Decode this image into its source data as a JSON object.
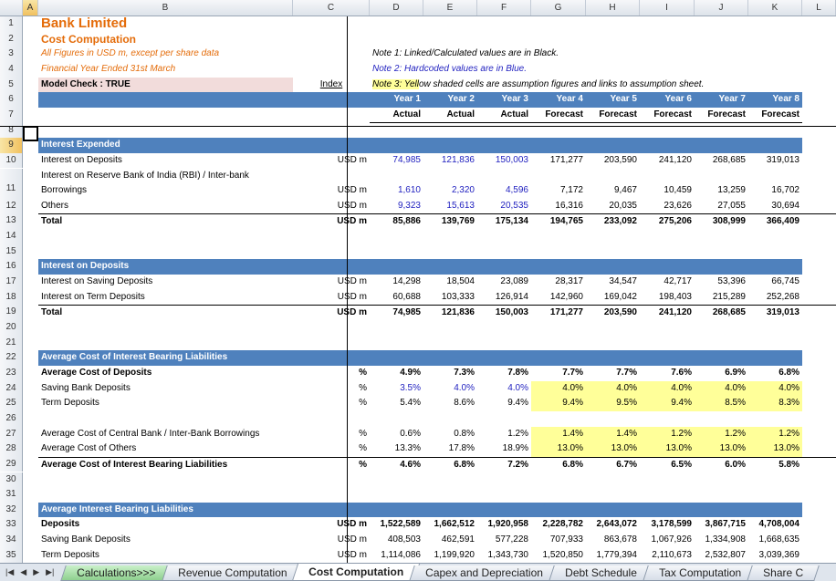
{
  "columns": [
    "",
    "A",
    "B",
    "C",
    "D",
    "E",
    "F",
    "G",
    "H",
    "I",
    "J",
    "K",
    "L"
  ],
  "header": {
    "title": "Bank Limited",
    "subtitle": "Cost Computation",
    "note_figures": "All Figures in USD m, except per share data",
    "note_fy": "Financial Year Ended 31st March",
    "model_check": "Model Check : TRUE",
    "index_link": "Index",
    "note1": "Note 1: Linked/Calculated values are in Black.",
    "note2": "Note 2: Hardcoded values are in Blue.",
    "note3": "Note 3: Yellow shaded cells are assumption figures and links to assumption sheet."
  },
  "years": [
    "Year 1",
    "Year 2",
    "Year 3",
    "Year 4",
    "Year 5",
    "Year 6",
    "Year 7",
    "Year 8"
  ],
  "types": [
    "Actual",
    "Actual",
    "Actual",
    "Forecast",
    "Forecast",
    "Forecast",
    "Forecast",
    "Forecast"
  ],
  "sections": {
    "interest_expended": "Interest Expended",
    "interest_on_deposits": "Interest on Deposits",
    "avg_cost": "Average Cost of Interest Bearing Liabilities",
    "avg_ibl": "Average Interest Bearing Liabilities"
  },
  "rows": {
    "r10": {
      "label": "Interest on Deposits",
      "unit": "USD m",
      "v": [
        "74,985",
        "121,836",
        "150,003",
        "171,277",
        "203,590",
        "241,120",
        "268,685",
        "319,013"
      ]
    },
    "r10b": {
      "label": "Interest on Reserve Bank of India (RBI) / Inter-bank"
    },
    "r11": {
      "label": "Borrowings",
      "unit": "USD m",
      "v": [
        "1,610",
        "2,320",
        "4,596",
        "7,172",
        "9,467",
        "10,459",
        "13,259",
        "16,702"
      ]
    },
    "r12": {
      "label": "Others",
      "unit": "USD m",
      "v": [
        "9,323",
        "15,613",
        "20,535",
        "16,316",
        "20,035",
        "23,626",
        "27,055",
        "30,694"
      ]
    },
    "r13": {
      "label": "Total",
      "unit": "USD m",
      "v": [
        "85,886",
        "139,769",
        "175,134",
        "194,765",
        "233,092",
        "275,206",
        "308,999",
        "366,409"
      ]
    },
    "r17": {
      "label": "Interest on Saving Deposits",
      "unit": "USD m",
      "v": [
        "14,298",
        "18,504",
        "23,089",
        "28,317",
        "34,547",
        "42,717",
        "53,396",
        "66,745"
      ]
    },
    "r18": {
      "label": "Interest on Term Deposits",
      "unit": "USD m",
      "v": [
        "60,688",
        "103,333",
        "126,914",
        "142,960",
        "169,042",
        "198,403",
        "215,289",
        "252,268"
      ]
    },
    "r19": {
      "label": "Total",
      "unit": "USD m",
      "v": [
        "74,985",
        "121,836",
        "150,003",
        "171,277",
        "203,590",
        "241,120",
        "268,685",
        "319,013"
      ]
    },
    "r23": {
      "label": "Average Cost of Deposits",
      "unit": "%",
      "v": [
        "4.9%",
        "7.3%",
        "7.8%",
        "7.7%",
        "7.7%",
        "7.6%",
        "6.9%",
        "6.8%"
      ]
    },
    "r24": {
      "label": "Saving Bank Deposits",
      "unit": "%",
      "v": [
        "3.5%",
        "4.0%",
        "4.0%",
        "4.0%",
        "4.0%",
        "4.0%",
        "4.0%",
        "4.0%"
      ]
    },
    "r25": {
      "label": "Term Deposits",
      "unit": "%",
      "v": [
        "5.4%",
        "8.6%",
        "9.4%",
        "9.4%",
        "9.5%",
        "9.4%",
        "8.5%",
        "8.3%"
      ]
    },
    "r27": {
      "label": "Average Cost of Central Bank / Inter-Bank Borrowings",
      "unit": "%",
      "v": [
        "0.6%",
        "0.8%",
        "1.2%",
        "1.4%",
        "1.4%",
        "1.2%",
        "1.2%",
        "1.2%"
      ]
    },
    "r28": {
      "label": "Average Cost of Others",
      "unit": "%",
      "v": [
        "13.3%",
        "17.8%",
        "18.9%",
        "13.0%",
        "13.0%",
        "13.0%",
        "13.0%",
        "13.0%"
      ]
    },
    "r29": {
      "label": "Average Cost of Interest Bearing Liabilities",
      "unit": "%",
      "v": [
        "4.6%",
        "6.8%",
        "7.2%",
        "6.8%",
        "6.7%",
        "6.5%",
        "6.0%",
        "5.8%"
      ]
    },
    "r33": {
      "label": "Deposits",
      "unit": "USD m",
      "v": [
        "1,522,589",
        "1,662,512",
        "1,920,958",
        "2,228,782",
        "2,643,072",
        "3,178,599",
        "3,867,715",
        "4,708,004"
      ]
    },
    "r34": {
      "label": "Saving Bank Deposits",
      "unit": "USD m",
      "v": [
        "408,503",
        "462,591",
        "577,228",
        "707,933",
        "863,678",
        "1,067,926",
        "1,334,908",
        "1,668,635"
      ]
    },
    "r35": {
      "label": "Term Deposits",
      "unit": "USD m",
      "v": [
        "1,114,086",
        "1,199,920",
        "1,343,730",
        "1,520,850",
        "1,779,394",
        "2,110,673",
        "2,532,807",
        "3,039,369"
      ]
    }
  },
  "tabs": [
    "Calculations>>>",
    "Revenue Computation",
    "Cost Computation",
    "Capex and Depreciation",
    "Debt Schedule",
    "Tax Computation",
    "Share C"
  ],
  "nav": [
    "|◀",
    "◀",
    "▶",
    "▶|"
  ]
}
